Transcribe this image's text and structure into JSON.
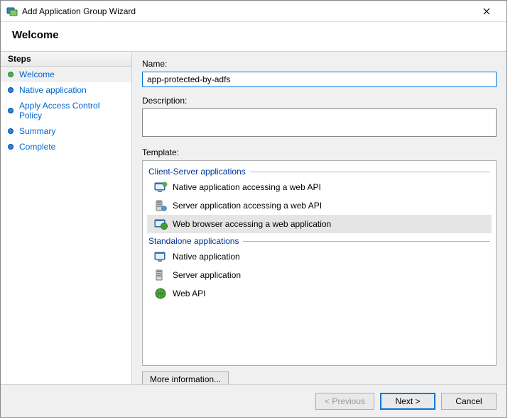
{
  "window": {
    "title": "Add Application Group Wizard",
    "welcome_header": "Welcome"
  },
  "sidebar": {
    "header": "Steps",
    "items": [
      {
        "label": "Welcome",
        "current": true,
        "bullet": "green"
      },
      {
        "label": "Native application",
        "current": false,
        "bullet": "blue"
      },
      {
        "label": "Apply Access Control Policy",
        "current": false,
        "bullet": "blue"
      },
      {
        "label": "Summary",
        "current": false,
        "bullet": "blue"
      },
      {
        "label": "Complete",
        "current": false,
        "bullet": "blue"
      }
    ]
  },
  "form": {
    "name_label": "Name:",
    "name_value": "app-protected-by-adfs",
    "description_label": "Description:",
    "description_value": "",
    "template_label": "Template:"
  },
  "templates": {
    "groups": [
      {
        "header": "Client-Server applications",
        "items": [
          {
            "label": "Native application accessing a web API",
            "icon": "native-api",
            "selected": false
          },
          {
            "label": "Server application accessing a web API",
            "icon": "server-api",
            "selected": false
          },
          {
            "label": "Web browser accessing a web application",
            "icon": "browser-web",
            "selected": true
          }
        ]
      },
      {
        "header": "Standalone applications",
        "items": [
          {
            "label": "Native application",
            "icon": "native",
            "selected": false
          },
          {
            "label": "Server application",
            "icon": "server",
            "selected": false
          },
          {
            "label": "Web API",
            "icon": "globe",
            "selected": false
          }
        ]
      }
    ],
    "more_info": "More information..."
  },
  "footer": {
    "previous": "< Previous",
    "next": "Next >",
    "cancel": "Cancel"
  }
}
